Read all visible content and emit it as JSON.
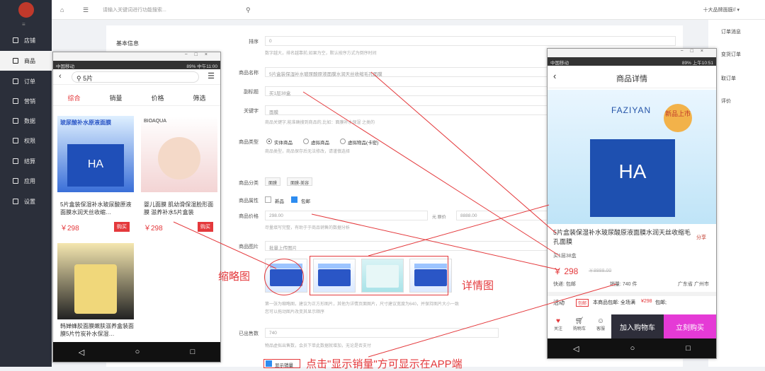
{
  "sidebar": {
    "items": [
      {
        "label": "店铺",
        "icon": "store-icon"
      },
      {
        "label": "商品",
        "icon": "goods-icon"
      },
      {
        "label": "订单",
        "icon": "order-icon"
      },
      {
        "label": "营销",
        "icon": "marketing-icon"
      },
      {
        "label": "数据",
        "icon": "data-icon"
      },
      {
        "label": "权限",
        "icon": "permission-icon"
      },
      {
        "label": "结算",
        "icon": "settle-icon"
      },
      {
        "label": "应用",
        "icon": "app-icon"
      },
      {
        "label": "设置",
        "icon": "settings-icon"
      }
    ]
  },
  "topbar": {
    "search_placeholder": "请输入关键词进行功能搜索...",
    "store": "十大品牌面膜// ▾"
  },
  "form": {
    "section_basic": "基本信息",
    "sort_label": "排序",
    "sort_value": "0",
    "sort_help": "数字越大，排名越靠前,如果为空，默认按序方式为倒序时间",
    "name_label": "商品名称",
    "name_value": "5片盒装保湿补水玻尿酸原液面膜水润天丝收缩毛孔面膜",
    "subtitle_label": "副标题",
    "subtitle_value": "买1层38盒",
    "keyword_label": "关键字",
    "keyword_value": "面膜",
    "keyword_help": "商品关键字,能准确搜到商品的,比如：面膜补水保湿 之类的",
    "type_label": "商品类型",
    "type_options": [
      "实体商品",
      "虚拟商品",
      "虚拟物品(卡密)"
    ],
    "type_help": "商品类型，商品保存后无法修改，请谨慎选择",
    "category_label": "商品分类",
    "categories": [
      "面膜",
      "面膜-美容"
    ],
    "attr_label": "商品属性",
    "attr_options": [
      "新品",
      "包邮"
    ],
    "price_label": "商品价格",
    "price_value": "298.00",
    "price_unit": "元 原价",
    "orig_price": "8888.00",
    "price_help": "尽量填写完整，有助于于商品销售的数据分析",
    "images_label": "商品图片",
    "images_upload": "批量上传图片",
    "images_help": "第一张为缩略图，建议为正方形图片，其他为详情页面图片，尺寸建议宽度为640，并保持图片大小一致",
    "images_help2": "您可以拖动图片改变其显示顺序",
    "sold_label": "已出售数",
    "sold_value": "740",
    "sold_help": "物品虚拟出售数，会员下单此数据就增加，无论是否支付",
    "show_sold": "显示销量"
  },
  "rightpanel": {
    "items": [
      "订单消息",
      "变货订单",
      "取订单",
      "评价"
    ]
  },
  "annotations": {
    "thumb": "缩略图",
    "detail": "详情图",
    "bottom": "点击\"显示销量\"方可显示在APP端"
  },
  "phone_left": {
    "status_left": "中国移动",
    "status_right": "89% 中午11:00",
    "search": "5片",
    "tabs": [
      "综合",
      "销量",
      "价格",
      "筛选"
    ],
    "products": [
      {
        "title": "5片盒装保湿补水玻尿酸原液面膜水润天丝收缩…",
        "price": "￥298",
        "buy": "购买",
        "img_text": "玻尿酸补水原液面膜"
      },
      {
        "title": "婴儿面膜 肌幼滑保湿脸形面膜 滋养补水5片盒装",
        "price": "￥298",
        "buy": "购买",
        "img_text": "BIOAQUA"
      },
      {
        "title": "韩婵蜂胶面膜嫩肤滋养盒装面膜5片竹炭补水保湿…",
        "price": "",
        "buy": "",
        "img_text": ""
      }
    ]
  },
  "phone_right": {
    "status_left": "中国移动",
    "status_right": "89% 上午10:51",
    "title": "商品详情",
    "brand": "FAZIYAN",
    "badge": "新品上市",
    "ha": "HA",
    "name": "5片盒装保湿补水玻尿酸原液面膜水润天丝收缩毛孔面膜",
    "share": "分享",
    "subtitle": "买1层38盒",
    "price": "￥ 298",
    "orig": "￥8888.00",
    "shipping": "快递: 包邮",
    "sales": "销量: 740 件",
    "location": "广东省 广州市",
    "activity_label": "活动",
    "activity_tag": "包邮",
    "activity_text": "本商品包邮: 全场满",
    "activity_price": "¥298",
    "activity_end": "包邮;",
    "bottom": {
      "fav": "关注",
      "cart": "购物车",
      "service": "客服",
      "cart_count": "2",
      "add": "加入购物车",
      "buy": "立刻购买"
    }
  },
  "colors": {
    "accent": "#e4393c",
    "sidebar": "#2b2f3a",
    "buy": "#e53ad6"
  }
}
